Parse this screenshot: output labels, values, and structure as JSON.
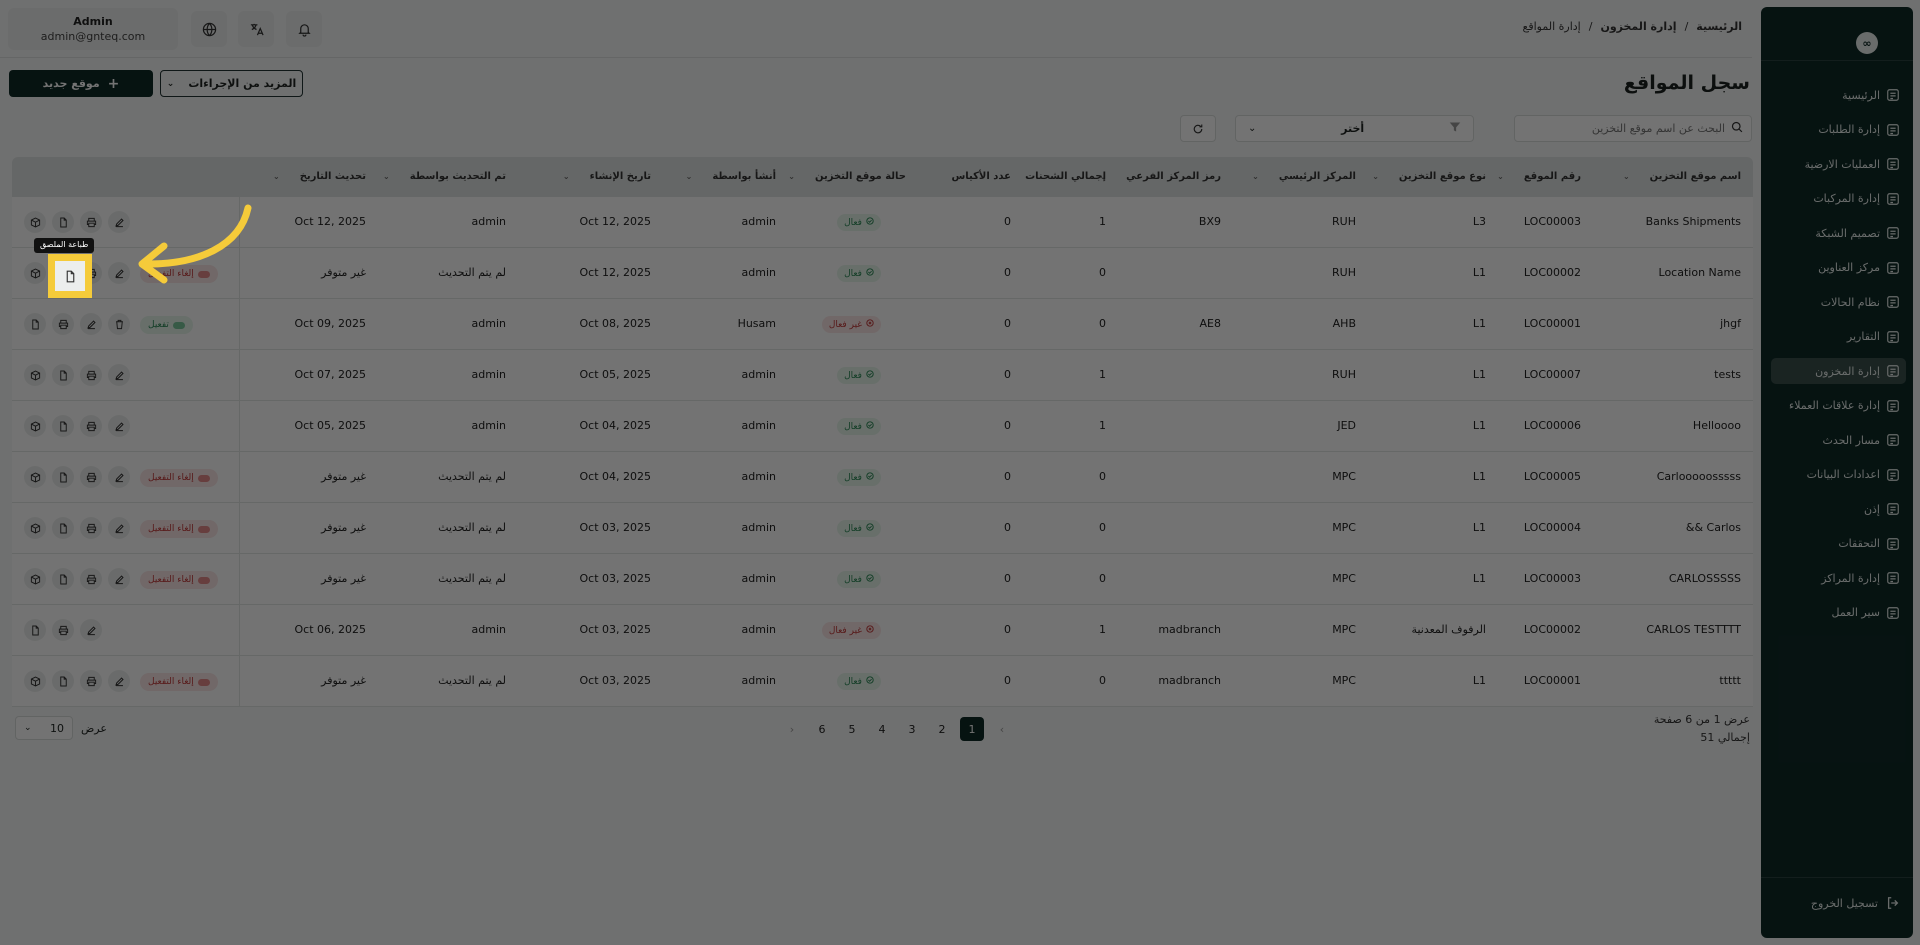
{
  "sidebar": {
    "logo": "∞",
    "items": [
      {
        "label": "الرئيسية",
        "icon": "grid-icon",
        "active": false
      },
      {
        "label": "إدارة الطلبات",
        "icon": "box-icon",
        "active": false
      },
      {
        "label": "العمليات الارضية",
        "icon": "sun-icon",
        "active": false
      },
      {
        "label": "إدارة المركبات",
        "icon": "truck-icon",
        "active": false
      },
      {
        "label": "تصميم الشبكة",
        "icon": "network-icon",
        "active": false
      },
      {
        "label": "مركز العناوين",
        "icon": "location-icon",
        "active": false
      },
      {
        "label": "نظام الحالات",
        "icon": "status-icon",
        "active": false
      },
      {
        "label": "التقارير",
        "icon": "report-icon",
        "active": false
      },
      {
        "label": "إدارة المخزون",
        "icon": "inventory-icon",
        "active": true
      },
      {
        "label": "إدارة علاقات العملاء",
        "icon": "crm-icon",
        "active": false
      },
      {
        "label": "مسار الحدث",
        "icon": "route-icon",
        "active": false
      },
      {
        "label": "اعدادات البيانات",
        "icon": "database-icon",
        "active": false
      },
      {
        "label": "إذن",
        "icon": "users-icon",
        "active": false
      },
      {
        "label": "التحققات",
        "icon": "tools-icon",
        "active": false
      },
      {
        "label": "إدارة المراكز",
        "icon": "center-icon",
        "active": false
      },
      {
        "label": "سير العمل",
        "icon": "workflow-icon",
        "active": false
      }
    ],
    "logout": "تسجيل الخروج"
  },
  "topbar": {
    "user_name": "Admin",
    "user_email": "admin@gnteq.com",
    "breadcrumb": [
      "الرئيسية",
      "/",
      "إدارة المخزون",
      "/",
      "إدارة المواقع"
    ]
  },
  "page": {
    "title": "سجل المواقع",
    "new_button": "موقع جديد",
    "more_button": "المزيد من الإجراءات",
    "search_placeholder": "البحث عن اسم موقع التخزين",
    "filter_select": "أختر",
    "tooltip": "طباعة الملصق"
  },
  "table": {
    "headers": [
      "اسم موقع التخزين",
      "رقم الموقع",
      "نوع موقع التخزين",
      "المركز الرئيسي",
      "رمز المركز الفرعي",
      "إجمالي الشحنات",
      "عدد الأكياس",
      "حالة موقع التخزين",
      "أنشأ بواسطة",
      "تاريخ الإنشاء",
      "تم التحديث بواسطة",
      "تحديث التاريخ"
    ],
    "rows": [
      {
        "name": "Banks Shipments",
        "code": "LOC00003",
        "type": "L3",
        "hub": "RUH",
        "sub": "BX9",
        "shipments": "1",
        "bags": "0",
        "status": "فعال",
        "status_active": true,
        "created_by": "admin",
        "created": "Oct 12, 2025",
        "updated_by": "admin",
        "updated": "Oct 12, 2025",
        "toggle": "",
        "icons": "four"
      },
      {
        "name": "Location Name",
        "code": "LOC00002",
        "type": "L1",
        "hub": "RUH",
        "sub": "",
        "shipments": "0",
        "bags": "0",
        "status": "فعال",
        "status_active": true,
        "created_by": "admin",
        "created": "Oct 12, 2025",
        "updated_by": "لم يتم التحديث",
        "updated": "غير متوفر",
        "toggle": "إلغاء التفعيل",
        "icons": "four"
      },
      {
        "name": "jhgf",
        "code": "LOC00001",
        "type": "L1",
        "hub": "AHB",
        "sub": "AE8",
        "shipments": "0",
        "bags": "0",
        "status": "غير فعال",
        "status_active": false,
        "created_by": "Husam",
        "created": "Oct 08, 2025",
        "updated_by": "admin",
        "updated": "Oct 09, 2025",
        "toggle": "تفعيل",
        "icons": "trash"
      },
      {
        "name": "tests",
        "code": "LOC00007",
        "type": "L1",
        "hub": "RUH",
        "sub": "",
        "shipments": "1",
        "bags": "0",
        "status": "فعال",
        "status_active": true,
        "created_by": "admin",
        "created": "Oct 05, 2025",
        "updated_by": "admin",
        "updated": "Oct 07, 2025",
        "toggle": "",
        "icons": "four"
      },
      {
        "name": "Helloooo",
        "code": "LOC00006",
        "type": "L1",
        "hub": "JED",
        "sub": "",
        "shipments": "1",
        "bags": "0",
        "status": "فعال",
        "status_active": true,
        "created_by": "admin",
        "created": "Oct 04, 2025",
        "updated_by": "admin",
        "updated": "Oct 05, 2025",
        "toggle": "",
        "icons": "four"
      },
      {
        "name": "Carlooooosssss",
        "code": "LOC00005",
        "type": "L1",
        "hub": "MPC",
        "sub": "",
        "shipments": "0",
        "bags": "0",
        "status": "فعال",
        "status_active": true,
        "created_by": "admin",
        "created": "Oct 04, 2025",
        "updated_by": "لم يتم التحديث",
        "updated": "غير متوفر",
        "toggle": "إلغاء التفعيل",
        "icons": "four"
      },
      {
        "name": "&& Carlos",
        "code": "LOC00004",
        "type": "L1",
        "hub": "MPC",
        "sub": "",
        "shipments": "0",
        "bags": "0",
        "status": "فعال",
        "status_active": true,
        "created_by": "admin",
        "created": "Oct 03, 2025",
        "updated_by": "لم يتم التحديث",
        "updated": "غير متوفر",
        "toggle": "إلغاء التفعيل",
        "icons": "four"
      },
      {
        "name": "CARLOSSSSS",
        "code": "LOC00003",
        "type": "L1",
        "hub": "MPC",
        "sub": "",
        "shipments": "0",
        "bags": "0",
        "status": "فعال",
        "status_active": true,
        "created_by": "admin",
        "created": "Oct 03, 2025",
        "updated_by": "لم يتم التحديث",
        "updated": "غير متوفر",
        "toggle": "إلغاء التفعيل",
        "icons": "four"
      },
      {
        "name": "CARLOS TESTTTT",
        "code": "LOC00002",
        "type": "الرفوف المعدنية",
        "hub": "MPC",
        "sub": "madbranch",
        "shipments": "1",
        "bags": "0",
        "status": "غير فعال",
        "status_active": false,
        "created_by": "admin",
        "created": "Oct 03, 2025",
        "updated_by": "admin",
        "updated": "Oct 06, 2025",
        "toggle": "",
        "icons": "three"
      },
      {
        "name": "ttttt",
        "code": "LOC00001",
        "type": "L1",
        "hub": "MPC",
        "sub": "madbranch",
        "shipments": "0",
        "bags": "0",
        "status": "فعال",
        "status_active": true,
        "created_by": "admin",
        "created": "Oct 03, 2025",
        "updated_by": "لم يتم التحديث",
        "updated": "غير متوفر",
        "toggle": "إلغاء التفعيل",
        "icons": "four"
      }
    ]
  },
  "pagination": {
    "pages": [
      "1",
      "2",
      "3",
      "4",
      "5",
      "6"
    ],
    "current": "1",
    "info_line1": "عرض 1 من 6 صفحة",
    "info_line2": "إجمالي 51",
    "per_page_label": "عرض",
    "per_page_value": "10"
  },
  "colors": {
    "sidebar": "#0f2a27",
    "highlight": "#f5cb3a",
    "active_badge": "#2e8a57",
    "inactive_badge": "#c23b3b"
  }
}
